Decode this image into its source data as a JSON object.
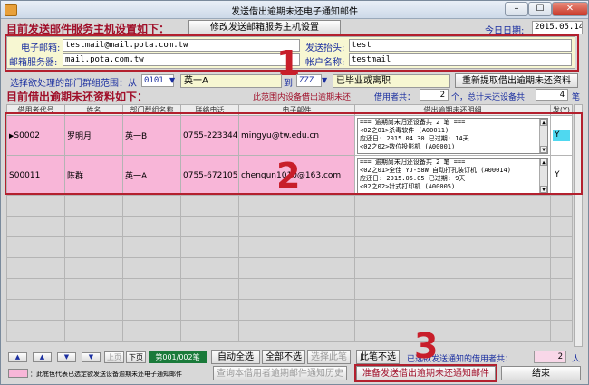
{
  "window": {
    "title": "发送借出逾期未还电子通知邮件",
    "minimize": "–",
    "maximize": "☐",
    "close": "✕"
  },
  "header": {
    "settings_heading": "目前发送邮件服务主机设置如下：",
    "edit_button": "修改发送邮箱服务主机设置",
    "date_label": "今日日期:",
    "date_value": "2015.05.14"
  },
  "mail": {
    "email_label": "电子邮箱:",
    "email_value": "testmail@mail.pota.com.tw",
    "server_label": "邮箱服务器:",
    "server_value": "mail.pota.com.tw",
    "sender_label": "发送抬头:",
    "sender_value": "test",
    "account_label": "帐户名称:",
    "account_value": "testmail"
  },
  "filter": {
    "range_label": "选择欲处理的部门群组范围：从",
    "from_code": "0101",
    "from_name": "英一A",
    "to_label": "到",
    "to_code": "ZZZ",
    "to_name": "已毕业或离职",
    "refresh_button": "重新提取借出逾期未还资料"
  },
  "summary": {
    "list_heading": "目前借出逾期未还资料如下：",
    "scope_text": "此范围内设备借出逾期未还",
    "borrowers_label": "借用者共：",
    "borrowers_count": "2",
    "mid_text": "个，总计未还设备共",
    "items_count": "4",
    "items_unit": "笔"
  },
  "table": {
    "columns": [
      "借用者代号",
      "姓名",
      "部门群组名称",
      "联络电话",
      "电子邮件",
      "借出逾期未还明细",
      "发(Y)"
    ],
    "rows": [
      {
        "id": "S0002",
        "name": "罗明月",
        "group": "英一B",
        "phone": "0755-22334455",
        "email": "mingyu@tw.edu.cn",
        "detail": [
          "=== 逾期尚未归还设备共  2 笔 ===",
          "<02之01>杀毒软件 (A00011)",
          "      应还日: 2015.04.30 已过期:    14天",
          "<02之02>数位投影机 (A00001)"
        ],
        "send": "Y"
      },
      {
        "id": "S00011",
        "name": "陈群",
        "group": "英一A",
        "phone": "0755-6721058",
        "email": "chenqun1010@163.com",
        "detail": [
          "=== 逾期尚未归还设备共  2 笔 ===",
          "<02之01>全佳 YJ-58W 自动打孔装订机 (A00014)",
          "      应还日: 2015.05.05 已过期:     9天",
          "<02之02>针式打印机 (A00005)"
        ],
        "send": "Y"
      }
    ]
  },
  "nav": {
    "first": "▲",
    "prev": "▲",
    "next": "▼",
    "last": "▼",
    "prev_page": "上页",
    "next_page": "下页",
    "page": "第001/002笔"
  },
  "bottom": {
    "auto_select": "自动全选",
    "deselect_all": "全部不选",
    "select_this": "选择此笔",
    "deselect_this": "此笔不选",
    "recipients_label": "已选欲发送通知的借用者共：",
    "recipients_count": "2",
    "recipients_unit": "人",
    "legend_text": "：此底色代表已选定欲发送设备逾期未还电子通知邮件",
    "history_button": "查询本借用者逾期邮件通知历史",
    "send_button": "准备发送借出逾期未还通知邮件",
    "close_button": "结束"
  },
  "callouts": [
    "1",
    "2",
    "3"
  ],
  "colors": {
    "selected_row": "#f8b6d8",
    "heading_red": "#a0102a",
    "callout_red": "#c81e2a"
  }
}
